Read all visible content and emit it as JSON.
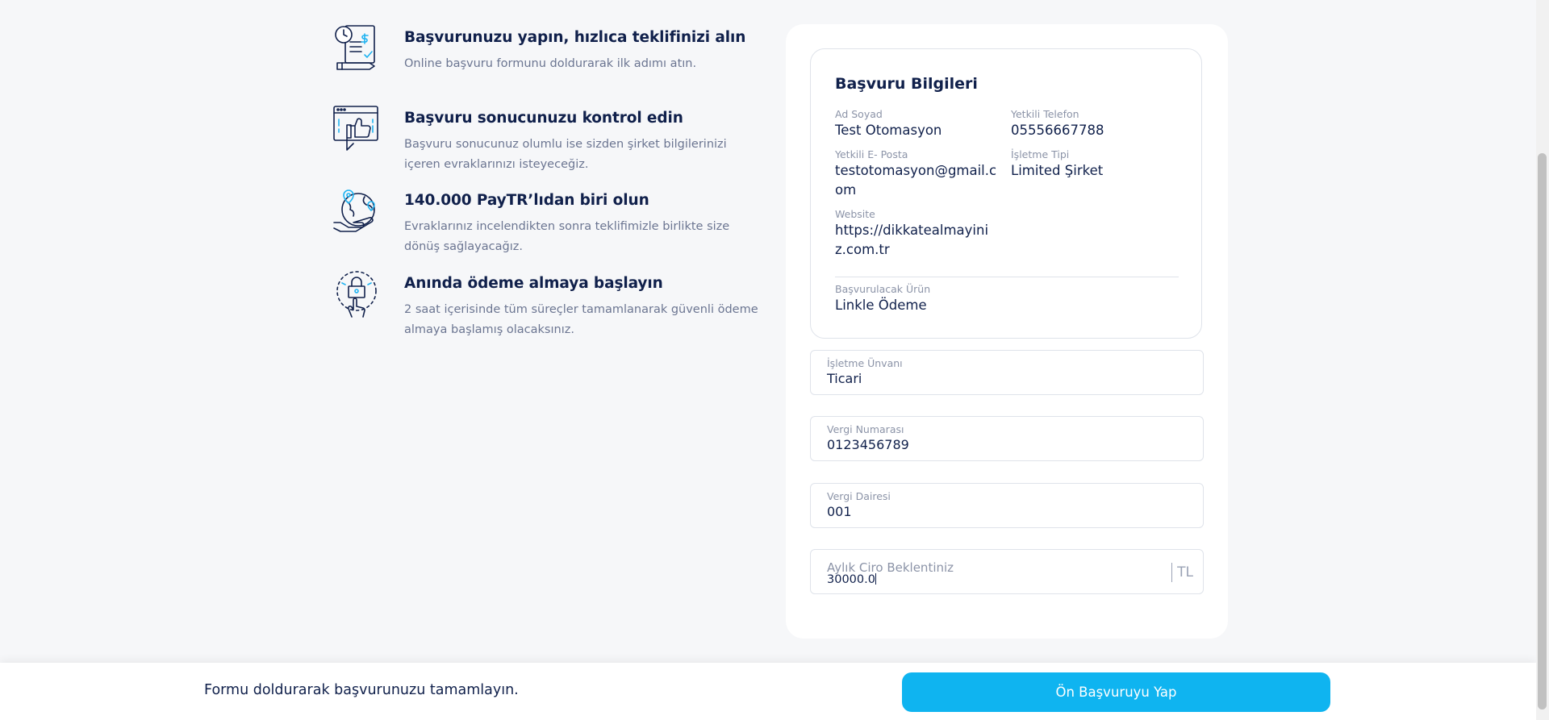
{
  "steps": [
    {
      "icon": "application-document-icon",
      "title": "Başvurunuzu yapın, hızlıca teklifinizi alın",
      "text": "Online başvuru formunu doldurarak ilk adımı atın."
    },
    {
      "icon": "thumbs-up-browser-icon",
      "title": "Başvuru sonucunuzu kontrol edin",
      "text": "Başvuru sonucunuz olumlu ise sizden şirket bilgilerinizi içeren evraklarınızı isteyeceğiz."
    },
    {
      "icon": "globe-hand-icon",
      "title": "140.000 PayTR’lıdan biri olun",
      "text": "Evraklarınız incelendikten sonra teklifimizle birlikte size dönüş sağlayacağız."
    },
    {
      "icon": "secure-payment-touch-icon",
      "title": "Anında ödeme almaya başlayın",
      "text": "2 saat içerisinde tüm süreçler tamamlanarak güvenli ödeme almaya başlamış olacaksınız."
    }
  ],
  "summary": {
    "title": "Başvuru Bilgileri",
    "name_label": "Ad Soyad",
    "name_value": "Test Otomasyon",
    "phone_label": "Yetkili Telefon",
    "phone_value": "05556667788",
    "email_label": "Yetkili E- Posta",
    "email_value": "testotomasyon@gmail.com",
    "type_label": "İşletme Tipi",
    "type_value": "Limited Şirket",
    "website_label": "Website",
    "website_value": "https://dikkatealmayiniz.com.tr",
    "product_label": "Başvurulacak Ürün",
    "product_value": "Linkle Ödeme"
  },
  "form": {
    "title_label": "İşletme Ünvanı",
    "title_value": "Ticari",
    "taxno_label": "Vergi Numarası",
    "taxno_value": "0123456789",
    "taxoffice_label": "Vergi Dairesi",
    "taxoffice_value": "001",
    "ciro_label": "Aylık Ciro Beklentiniz",
    "ciro_value": "30000.0",
    "ciro_suffix": "TL"
  },
  "footer": {
    "message": "Formu doldurarak başvurunuzu tamamlayın.",
    "button": "Ön Başvuruyu Yap"
  },
  "colors": {
    "accent": "#0fb4f0",
    "text": "#10204b",
    "muted": "#6b7591",
    "icon_blue": "#1fb3f1"
  }
}
